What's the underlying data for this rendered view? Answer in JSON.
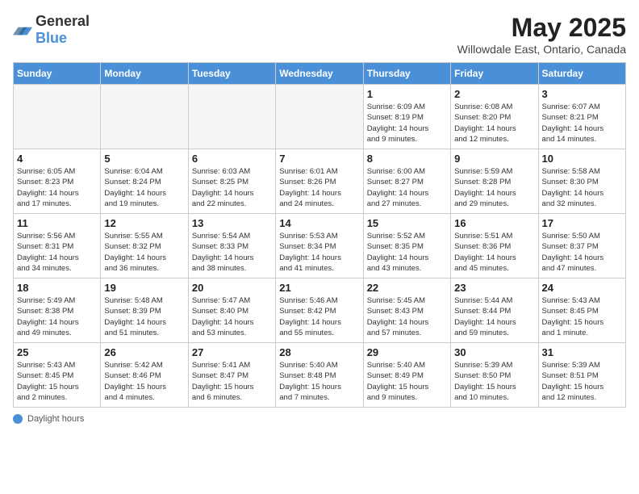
{
  "logo": {
    "general": "General",
    "blue": "Blue"
  },
  "title": "May 2025",
  "location": "Willowdale East, Ontario, Canada",
  "days_of_week": [
    "Sunday",
    "Monday",
    "Tuesday",
    "Wednesday",
    "Thursday",
    "Friday",
    "Saturday"
  ],
  "footer": {
    "label": "Daylight hours"
  },
  "weeks": [
    [
      {
        "day": "",
        "info": ""
      },
      {
        "day": "",
        "info": ""
      },
      {
        "day": "",
        "info": ""
      },
      {
        "day": "",
        "info": ""
      },
      {
        "day": "1",
        "info": "Sunrise: 6:09 AM\nSunset: 8:19 PM\nDaylight: 14 hours\nand 9 minutes."
      },
      {
        "day": "2",
        "info": "Sunrise: 6:08 AM\nSunset: 8:20 PM\nDaylight: 14 hours\nand 12 minutes."
      },
      {
        "day": "3",
        "info": "Sunrise: 6:07 AM\nSunset: 8:21 PM\nDaylight: 14 hours\nand 14 minutes."
      }
    ],
    [
      {
        "day": "4",
        "info": "Sunrise: 6:05 AM\nSunset: 8:23 PM\nDaylight: 14 hours\nand 17 minutes."
      },
      {
        "day": "5",
        "info": "Sunrise: 6:04 AM\nSunset: 8:24 PM\nDaylight: 14 hours\nand 19 minutes."
      },
      {
        "day": "6",
        "info": "Sunrise: 6:03 AM\nSunset: 8:25 PM\nDaylight: 14 hours\nand 22 minutes."
      },
      {
        "day": "7",
        "info": "Sunrise: 6:01 AM\nSunset: 8:26 PM\nDaylight: 14 hours\nand 24 minutes."
      },
      {
        "day": "8",
        "info": "Sunrise: 6:00 AM\nSunset: 8:27 PM\nDaylight: 14 hours\nand 27 minutes."
      },
      {
        "day": "9",
        "info": "Sunrise: 5:59 AM\nSunset: 8:28 PM\nDaylight: 14 hours\nand 29 minutes."
      },
      {
        "day": "10",
        "info": "Sunrise: 5:58 AM\nSunset: 8:30 PM\nDaylight: 14 hours\nand 32 minutes."
      }
    ],
    [
      {
        "day": "11",
        "info": "Sunrise: 5:56 AM\nSunset: 8:31 PM\nDaylight: 14 hours\nand 34 minutes."
      },
      {
        "day": "12",
        "info": "Sunrise: 5:55 AM\nSunset: 8:32 PM\nDaylight: 14 hours\nand 36 minutes."
      },
      {
        "day": "13",
        "info": "Sunrise: 5:54 AM\nSunset: 8:33 PM\nDaylight: 14 hours\nand 38 minutes."
      },
      {
        "day": "14",
        "info": "Sunrise: 5:53 AM\nSunset: 8:34 PM\nDaylight: 14 hours\nand 41 minutes."
      },
      {
        "day": "15",
        "info": "Sunrise: 5:52 AM\nSunset: 8:35 PM\nDaylight: 14 hours\nand 43 minutes."
      },
      {
        "day": "16",
        "info": "Sunrise: 5:51 AM\nSunset: 8:36 PM\nDaylight: 14 hours\nand 45 minutes."
      },
      {
        "day": "17",
        "info": "Sunrise: 5:50 AM\nSunset: 8:37 PM\nDaylight: 14 hours\nand 47 minutes."
      }
    ],
    [
      {
        "day": "18",
        "info": "Sunrise: 5:49 AM\nSunset: 8:38 PM\nDaylight: 14 hours\nand 49 minutes."
      },
      {
        "day": "19",
        "info": "Sunrise: 5:48 AM\nSunset: 8:39 PM\nDaylight: 14 hours\nand 51 minutes."
      },
      {
        "day": "20",
        "info": "Sunrise: 5:47 AM\nSunset: 8:40 PM\nDaylight: 14 hours\nand 53 minutes."
      },
      {
        "day": "21",
        "info": "Sunrise: 5:46 AM\nSunset: 8:42 PM\nDaylight: 14 hours\nand 55 minutes."
      },
      {
        "day": "22",
        "info": "Sunrise: 5:45 AM\nSunset: 8:43 PM\nDaylight: 14 hours\nand 57 minutes."
      },
      {
        "day": "23",
        "info": "Sunrise: 5:44 AM\nSunset: 8:44 PM\nDaylight: 14 hours\nand 59 minutes."
      },
      {
        "day": "24",
        "info": "Sunrise: 5:43 AM\nSunset: 8:45 PM\nDaylight: 15 hours\nand 1 minute."
      }
    ],
    [
      {
        "day": "25",
        "info": "Sunrise: 5:43 AM\nSunset: 8:45 PM\nDaylight: 15 hours\nand 2 minutes."
      },
      {
        "day": "26",
        "info": "Sunrise: 5:42 AM\nSunset: 8:46 PM\nDaylight: 15 hours\nand 4 minutes."
      },
      {
        "day": "27",
        "info": "Sunrise: 5:41 AM\nSunset: 8:47 PM\nDaylight: 15 hours\nand 6 minutes."
      },
      {
        "day": "28",
        "info": "Sunrise: 5:40 AM\nSunset: 8:48 PM\nDaylight: 15 hours\nand 7 minutes."
      },
      {
        "day": "29",
        "info": "Sunrise: 5:40 AM\nSunset: 8:49 PM\nDaylight: 15 hours\nand 9 minutes."
      },
      {
        "day": "30",
        "info": "Sunrise: 5:39 AM\nSunset: 8:50 PM\nDaylight: 15 hours\nand 10 minutes."
      },
      {
        "day": "31",
        "info": "Sunrise: 5:39 AM\nSunset: 8:51 PM\nDaylight: 15 hours\nand 12 minutes."
      }
    ]
  ]
}
